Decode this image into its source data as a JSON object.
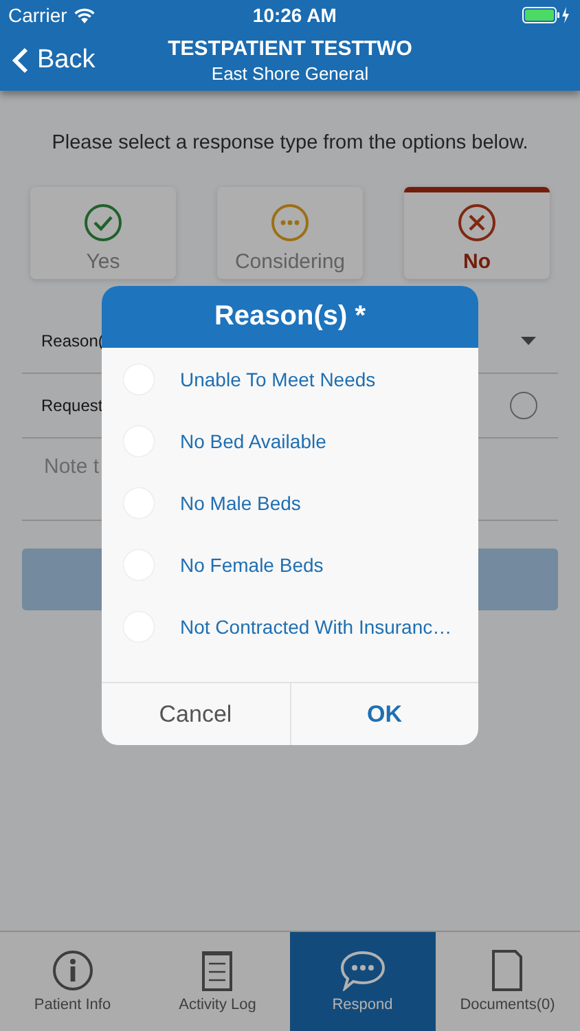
{
  "status_bar": {
    "carrier": "Carrier",
    "time": "10:26 AM"
  },
  "nav": {
    "back": "Back",
    "title": "TESTPATIENT TESTTWO",
    "subtitle": "East Shore General"
  },
  "prompt": "Please select a response type from the options below.",
  "responses": [
    {
      "kind": "yes",
      "label": "Yes",
      "selected": false
    },
    {
      "kind": "considering",
      "label": "Considering",
      "selected": false
    },
    {
      "kind": "no",
      "label": "No",
      "selected": true
    }
  ],
  "form": {
    "reason_label": "Reason(",
    "request_label": "Request",
    "request_checked": false,
    "note_placeholder": "Note t"
  },
  "dialog": {
    "title": "Reason(s) *",
    "options": [
      {
        "label": "Unable To Meet Needs",
        "checked": false
      },
      {
        "label": "No Bed Available",
        "checked": false
      },
      {
        "label": "No Male Beds",
        "checked": false
      },
      {
        "label": "No Female Beds",
        "checked": false
      },
      {
        "label": "Not Contracted With Insuranc…",
        "checked": false
      }
    ],
    "cancel": "Cancel",
    "ok": "OK"
  },
  "tabs": [
    {
      "kind": "info",
      "label": "Patient Info",
      "selected": false
    },
    {
      "kind": "log",
      "label": "Activity Log",
      "selected": false
    },
    {
      "kind": "respond",
      "label": "Respond",
      "selected": true
    },
    {
      "kind": "documents",
      "label": "Documents(0)",
      "selected": false
    }
  ]
}
